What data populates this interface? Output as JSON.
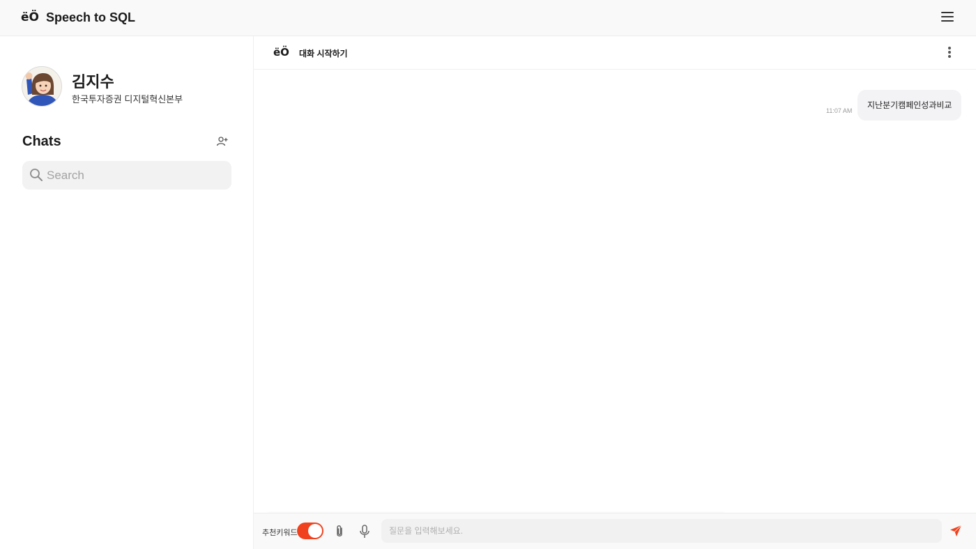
{
  "app": {
    "logo": "ëÖ",
    "title": "Speech to SQL"
  },
  "sidebar": {
    "user": {
      "name": "김지수",
      "organization": "한국투자증권 디지털혁신본부"
    },
    "chats_title": "Chats",
    "search": {
      "placeholder": "Search",
      "value": ""
    }
  },
  "chat": {
    "header": {
      "logo": "ëÖ",
      "title": "대화 시작하기"
    },
    "messages": [
      {
        "text": "지난분기캠페인성과비교",
        "time": "11:07 AM"
      }
    ]
  },
  "input_bar": {
    "keyword_label": "추천키워드",
    "keyword_toggle_on": true,
    "message_placeholder": "질문을 입력해보세요.",
    "message_value": ""
  },
  "colors": {
    "accent": "#f0421f",
    "bubble": "#f3f3f6",
    "search_bg": "#f2f2f2"
  },
  "icons": [
    "menu-icon",
    "add-user-icon",
    "search-icon",
    "more-vertical-icon",
    "paperclip-icon",
    "microphone-icon",
    "send-icon"
  ]
}
